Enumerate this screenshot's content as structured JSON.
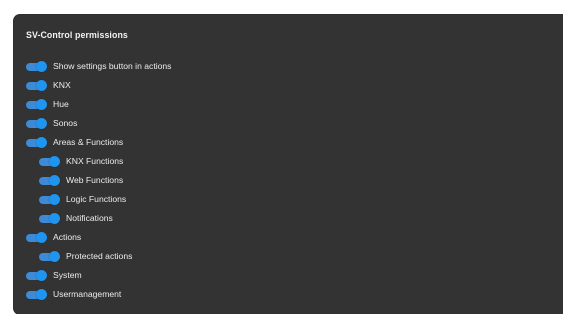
{
  "panel": {
    "title": "SV-Control permissions"
  },
  "colors": {
    "panel_bg": "#333333",
    "toggle_on": "#1f95f0",
    "text": "#ececec"
  },
  "permissions": [
    {
      "label": "Show settings button in actions",
      "enabled": true,
      "level": 0
    },
    {
      "label": "KNX",
      "enabled": true,
      "level": 0
    },
    {
      "label": "Hue",
      "enabled": true,
      "level": 0
    },
    {
      "label": "Sonos",
      "enabled": true,
      "level": 0
    },
    {
      "label": "Areas & Functions",
      "enabled": true,
      "level": 0
    },
    {
      "label": "KNX Functions",
      "enabled": true,
      "level": 1
    },
    {
      "label": "Web Functions",
      "enabled": true,
      "level": 1
    },
    {
      "label": "Logic Functions",
      "enabled": true,
      "level": 1
    },
    {
      "label": "Notifications",
      "enabled": true,
      "level": 1
    },
    {
      "label": "Actions",
      "enabled": true,
      "level": 0
    },
    {
      "label": "Protected actions",
      "enabled": true,
      "level": 1
    },
    {
      "label": "System",
      "enabled": true,
      "level": 0
    },
    {
      "label": "Usermanagement",
      "enabled": true,
      "level": 0
    }
  ]
}
